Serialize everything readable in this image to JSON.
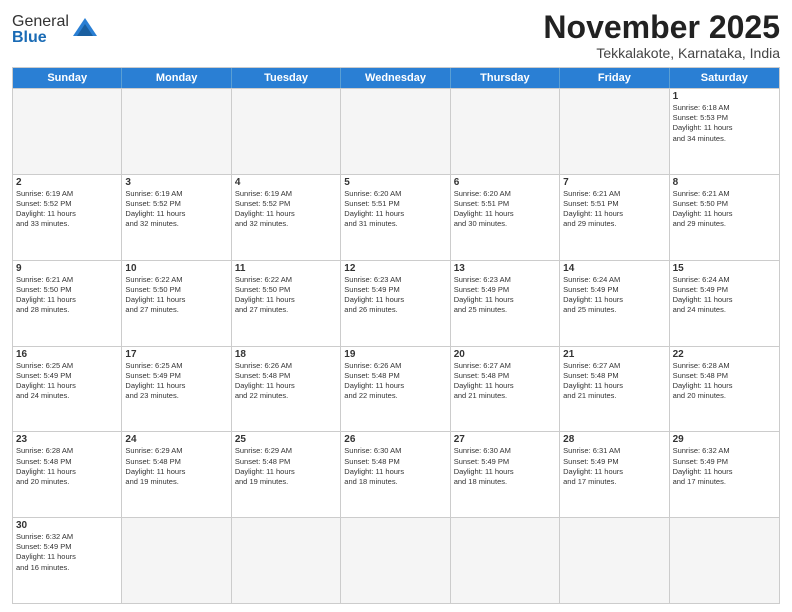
{
  "header": {
    "logo_general": "General",
    "logo_blue": "Blue",
    "month_title": "November 2025",
    "location": "Tekkalakote, Karnataka, India"
  },
  "days_of_week": [
    "Sunday",
    "Monday",
    "Tuesday",
    "Wednesday",
    "Thursday",
    "Friday",
    "Saturday"
  ],
  "weeks": [
    [
      {
        "num": "",
        "info": ""
      },
      {
        "num": "",
        "info": ""
      },
      {
        "num": "",
        "info": ""
      },
      {
        "num": "",
        "info": ""
      },
      {
        "num": "",
        "info": ""
      },
      {
        "num": "",
        "info": ""
      },
      {
        "num": "1",
        "info": "Sunrise: 6:18 AM\nSunset: 5:53 PM\nDaylight: 11 hours\nand 34 minutes."
      }
    ],
    [
      {
        "num": "2",
        "info": "Sunrise: 6:19 AM\nSunset: 5:52 PM\nDaylight: 11 hours\nand 33 minutes."
      },
      {
        "num": "3",
        "info": "Sunrise: 6:19 AM\nSunset: 5:52 PM\nDaylight: 11 hours\nand 32 minutes."
      },
      {
        "num": "4",
        "info": "Sunrise: 6:19 AM\nSunset: 5:52 PM\nDaylight: 11 hours\nand 32 minutes."
      },
      {
        "num": "5",
        "info": "Sunrise: 6:20 AM\nSunset: 5:51 PM\nDaylight: 11 hours\nand 31 minutes."
      },
      {
        "num": "6",
        "info": "Sunrise: 6:20 AM\nSunset: 5:51 PM\nDaylight: 11 hours\nand 30 minutes."
      },
      {
        "num": "7",
        "info": "Sunrise: 6:21 AM\nSunset: 5:51 PM\nDaylight: 11 hours\nand 29 minutes."
      },
      {
        "num": "8",
        "info": "Sunrise: 6:21 AM\nSunset: 5:50 PM\nDaylight: 11 hours\nand 29 minutes."
      }
    ],
    [
      {
        "num": "9",
        "info": "Sunrise: 6:21 AM\nSunset: 5:50 PM\nDaylight: 11 hours\nand 28 minutes."
      },
      {
        "num": "10",
        "info": "Sunrise: 6:22 AM\nSunset: 5:50 PM\nDaylight: 11 hours\nand 27 minutes."
      },
      {
        "num": "11",
        "info": "Sunrise: 6:22 AM\nSunset: 5:50 PM\nDaylight: 11 hours\nand 27 minutes."
      },
      {
        "num": "12",
        "info": "Sunrise: 6:23 AM\nSunset: 5:49 PM\nDaylight: 11 hours\nand 26 minutes."
      },
      {
        "num": "13",
        "info": "Sunrise: 6:23 AM\nSunset: 5:49 PM\nDaylight: 11 hours\nand 25 minutes."
      },
      {
        "num": "14",
        "info": "Sunrise: 6:24 AM\nSunset: 5:49 PM\nDaylight: 11 hours\nand 25 minutes."
      },
      {
        "num": "15",
        "info": "Sunrise: 6:24 AM\nSunset: 5:49 PM\nDaylight: 11 hours\nand 24 minutes."
      }
    ],
    [
      {
        "num": "16",
        "info": "Sunrise: 6:25 AM\nSunset: 5:49 PM\nDaylight: 11 hours\nand 24 minutes."
      },
      {
        "num": "17",
        "info": "Sunrise: 6:25 AM\nSunset: 5:49 PM\nDaylight: 11 hours\nand 23 minutes."
      },
      {
        "num": "18",
        "info": "Sunrise: 6:26 AM\nSunset: 5:48 PM\nDaylight: 11 hours\nand 22 minutes."
      },
      {
        "num": "19",
        "info": "Sunrise: 6:26 AM\nSunset: 5:48 PM\nDaylight: 11 hours\nand 22 minutes."
      },
      {
        "num": "20",
        "info": "Sunrise: 6:27 AM\nSunset: 5:48 PM\nDaylight: 11 hours\nand 21 minutes."
      },
      {
        "num": "21",
        "info": "Sunrise: 6:27 AM\nSunset: 5:48 PM\nDaylight: 11 hours\nand 21 minutes."
      },
      {
        "num": "22",
        "info": "Sunrise: 6:28 AM\nSunset: 5:48 PM\nDaylight: 11 hours\nand 20 minutes."
      }
    ],
    [
      {
        "num": "23",
        "info": "Sunrise: 6:28 AM\nSunset: 5:48 PM\nDaylight: 11 hours\nand 20 minutes."
      },
      {
        "num": "24",
        "info": "Sunrise: 6:29 AM\nSunset: 5:48 PM\nDaylight: 11 hours\nand 19 minutes."
      },
      {
        "num": "25",
        "info": "Sunrise: 6:29 AM\nSunset: 5:48 PM\nDaylight: 11 hours\nand 19 minutes."
      },
      {
        "num": "26",
        "info": "Sunrise: 6:30 AM\nSunset: 5:48 PM\nDaylight: 11 hours\nand 18 minutes."
      },
      {
        "num": "27",
        "info": "Sunrise: 6:30 AM\nSunset: 5:49 PM\nDaylight: 11 hours\nand 18 minutes."
      },
      {
        "num": "28",
        "info": "Sunrise: 6:31 AM\nSunset: 5:49 PM\nDaylight: 11 hours\nand 17 minutes."
      },
      {
        "num": "29",
        "info": "Sunrise: 6:32 AM\nSunset: 5:49 PM\nDaylight: 11 hours\nand 17 minutes."
      }
    ],
    [
      {
        "num": "30",
        "info": "Sunrise: 6:32 AM\nSunset: 5:49 PM\nDaylight: 11 hours\nand 16 minutes."
      },
      {
        "num": "",
        "info": ""
      },
      {
        "num": "",
        "info": ""
      },
      {
        "num": "",
        "info": ""
      },
      {
        "num": "",
        "info": ""
      },
      {
        "num": "",
        "info": ""
      },
      {
        "num": "",
        "info": ""
      }
    ]
  ]
}
